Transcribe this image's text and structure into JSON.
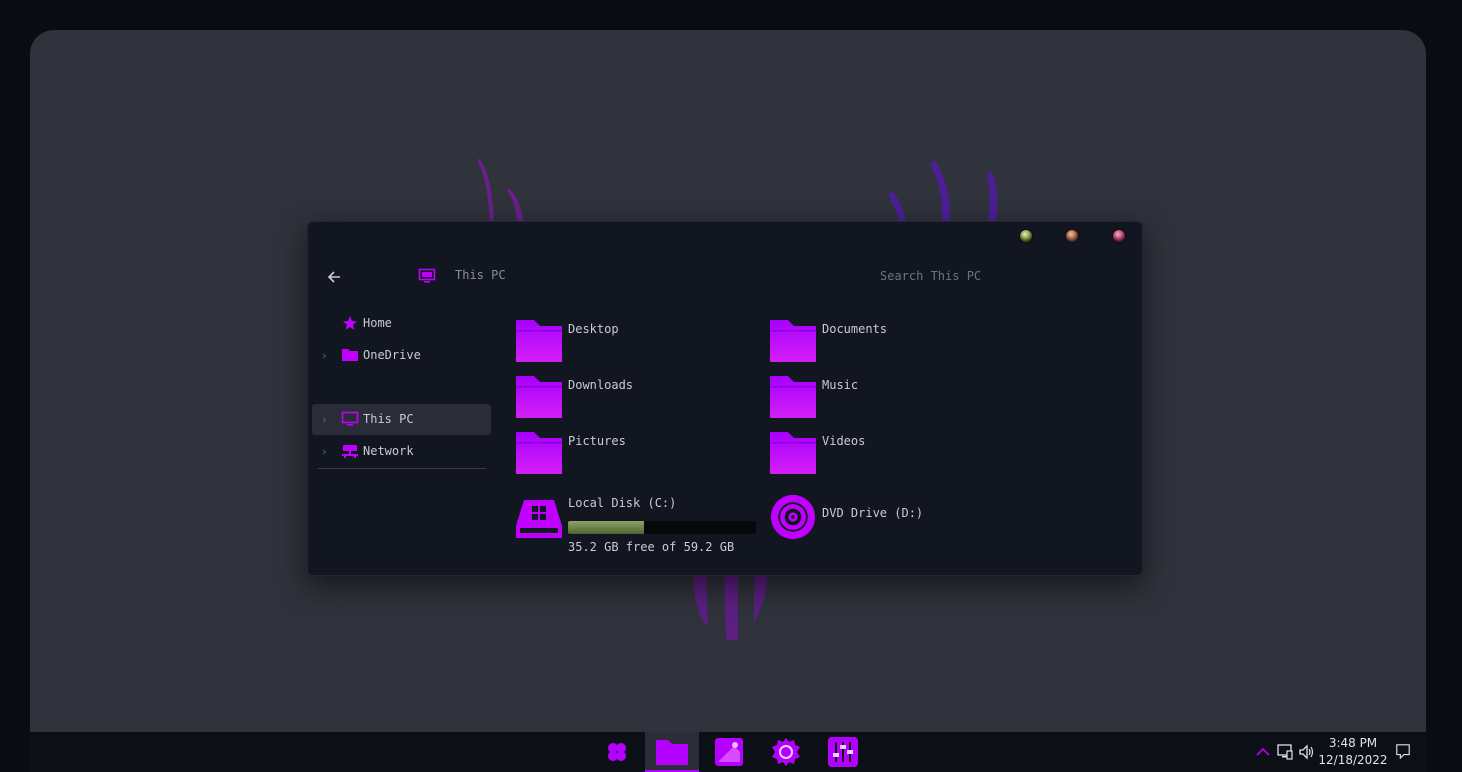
{
  "theme": {
    "accent": "#b400ff",
    "accent_light": "#d233ff",
    "window_bg": "#121620",
    "desktop_bg": "#30323c"
  },
  "window": {
    "title_buttons": [
      {
        "name": "minimize-button",
        "icon": "green-orb"
      },
      {
        "name": "maximize-button",
        "icon": "orange-orb"
      },
      {
        "name": "close-button",
        "icon": "red-orb"
      }
    ],
    "address": {
      "location": "This PC",
      "icon": "monitor-icon"
    },
    "search": {
      "placeholder": "Search This PC"
    }
  },
  "sidebar": {
    "items": [
      {
        "label": "Home",
        "icon": "star-icon",
        "expandable": false
      },
      {
        "label": "OneDrive",
        "icon": "folder-icon",
        "expandable": true
      },
      {
        "label": "This PC",
        "icon": "monitor-icon",
        "expandable": true,
        "selected": true
      },
      {
        "label": "Network",
        "icon": "network-icon",
        "expandable": true
      }
    ]
  },
  "folders": [
    {
      "label": "Desktop"
    },
    {
      "label": "Documents"
    },
    {
      "label": "Downloads"
    },
    {
      "label": "Music"
    },
    {
      "label": "Pictures"
    },
    {
      "label": "Videos"
    }
  ],
  "drives": {
    "local": {
      "label": "Local Disk (C:)",
      "free_text": "35.2 GB free of 59.2 GB",
      "used_fraction": 0.405
    },
    "dvd": {
      "label": "DVD Drive (D:)"
    }
  },
  "taskbar": {
    "apps": [
      "start-icon",
      "file-explorer-icon",
      "photos-icon",
      "settings-icon",
      "mixer-icon"
    ],
    "active": "file-explorer-icon",
    "tray": [
      "chevron-up-icon",
      "network-icon",
      "volume-icon"
    ],
    "time": "3:48 PM",
    "date": "12/18/2022"
  }
}
